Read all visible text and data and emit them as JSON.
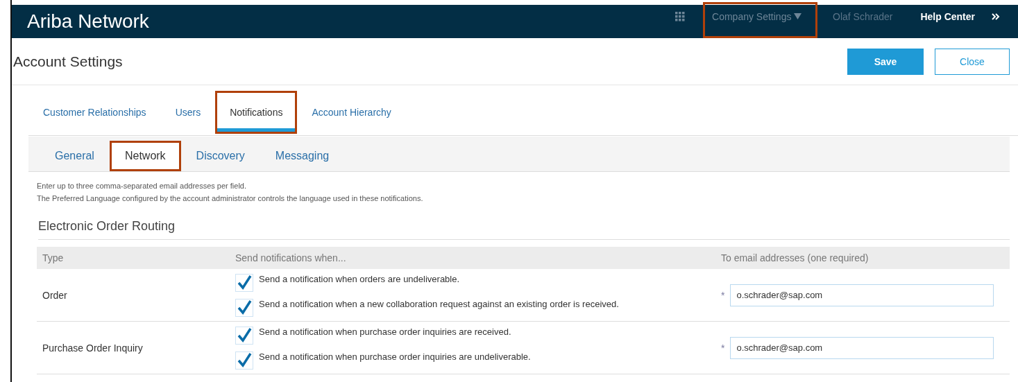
{
  "header": {
    "brand": "Ariba Network",
    "menu": {
      "label": "Company Settings",
      "highlighted": true
    },
    "user": "Olaf Schrader",
    "help": "Help Center"
  },
  "page": {
    "title": "Account Settings",
    "buttons": [
      {
        "label": "Save",
        "kind": "primary"
      },
      {
        "label": "Close",
        "kind": "secondary"
      }
    ]
  },
  "tabs": [
    {
      "label": "Customer Relationships",
      "selected": false,
      "highlighted": false
    },
    {
      "label": "Users",
      "selected": false,
      "highlighted": false
    },
    {
      "label": "Notifications",
      "selected": true,
      "highlighted": true
    },
    {
      "label": "Account Hierarchy",
      "selected": false,
      "highlighted": false
    }
  ],
  "subtabs": [
    {
      "label": "General",
      "selected": false,
      "highlighted": false
    },
    {
      "label": "Network",
      "selected": true,
      "highlighted": true
    },
    {
      "label": "Discovery",
      "selected": false,
      "highlighted": false
    },
    {
      "label": "Messaging",
      "selected": false,
      "highlighted": false
    }
  ],
  "info": [
    "Enter up to three comma-separated email addresses per field.",
    "The Preferred Language configured by the account administrator controls the language used in these notifications."
  ],
  "section": {
    "title": "Electronic Order Routing",
    "columns": [
      "Type",
      "Send notifications when...",
      "To email addresses (one required)"
    ],
    "rows": [
      {
        "type": "Order",
        "options": [
          {
            "label": "Send a notification when orders are undeliverable.",
            "checked": true
          },
          {
            "label": "Send a notification when a new collaboration request against an existing order is received.",
            "checked": true
          }
        ],
        "required": "*",
        "email": "o.schrader@sap.com"
      },
      {
        "type": "Purchase Order Inquiry",
        "options": [
          {
            "label": "Send a notification when purchase order inquiries are received.",
            "checked": true
          },
          {
            "label": "Send a notification when purchase order inquiries are undeliverable.",
            "checked": true
          }
        ],
        "required": "*",
        "email": "o.schrader@sap.com"
      }
    ]
  }
}
